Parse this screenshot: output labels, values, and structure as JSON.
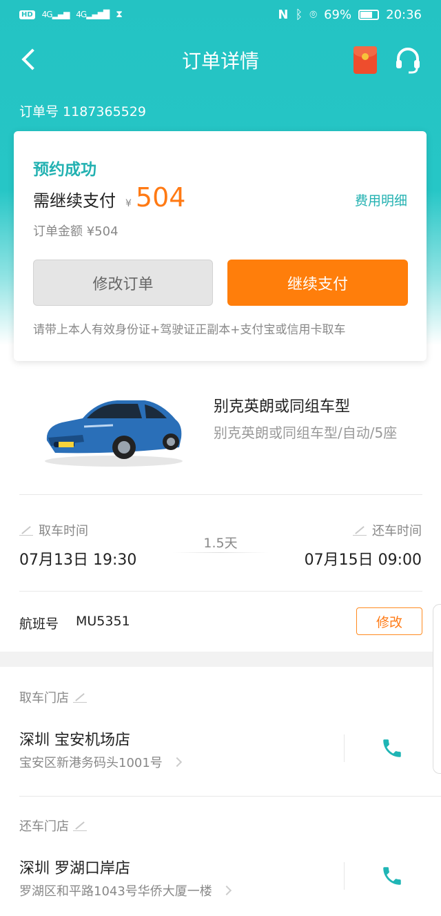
{
  "status_bar": {
    "left_hd": "HD",
    "signal1": "4G",
    "signal2": "4G",
    "battery": "69%",
    "time": "20:36"
  },
  "nav": {
    "title": "订单详情"
  },
  "order": {
    "number_text": "订单号 1187365529"
  },
  "card": {
    "status": "预约成功",
    "pay_label": "需继续支付",
    "currency": "¥",
    "amount": "504",
    "fee_detail_link": "费用明细",
    "order_amount": "订单金额 ¥504",
    "modify_button": "修改订单",
    "pay_button": "继续支付",
    "note": "请带上本人有效身份证+驾驶证正副本+支付宝或信用卡取车"
  },
  "car": {
    "name": "别克英朗或同组车型",
    "description": "别克英朗或同组车型/自动/5座"
  },
  "rental": {
    "pickup_label": "取车时间",
    "pickup_time": "07月13日 19:30",
    "duration": "1.5天",
    "return_label": "还车时间",
    "return_time": "07月15日 09:00"
  },
  "flight": {
    "label": "航班号",
    "number": "MU5351",
    "edit_button": "修改"
  },
  "pickup_store": {
    "section_label": "取车门店",
    "name": "深圳 宝安机场店",
    "address": "宝安区新港务码头1001号"
  },
  "return_store": {
    "section_label": "还车门店",
    "name": "深圳 罗湖口岸店",
    "address": "罗湖区和平路1043号华侨大厦一楼"
  },
  "colors": {
    "teal": "#26c2c2",
    "orange": "#ff7e0b"
  }
}
